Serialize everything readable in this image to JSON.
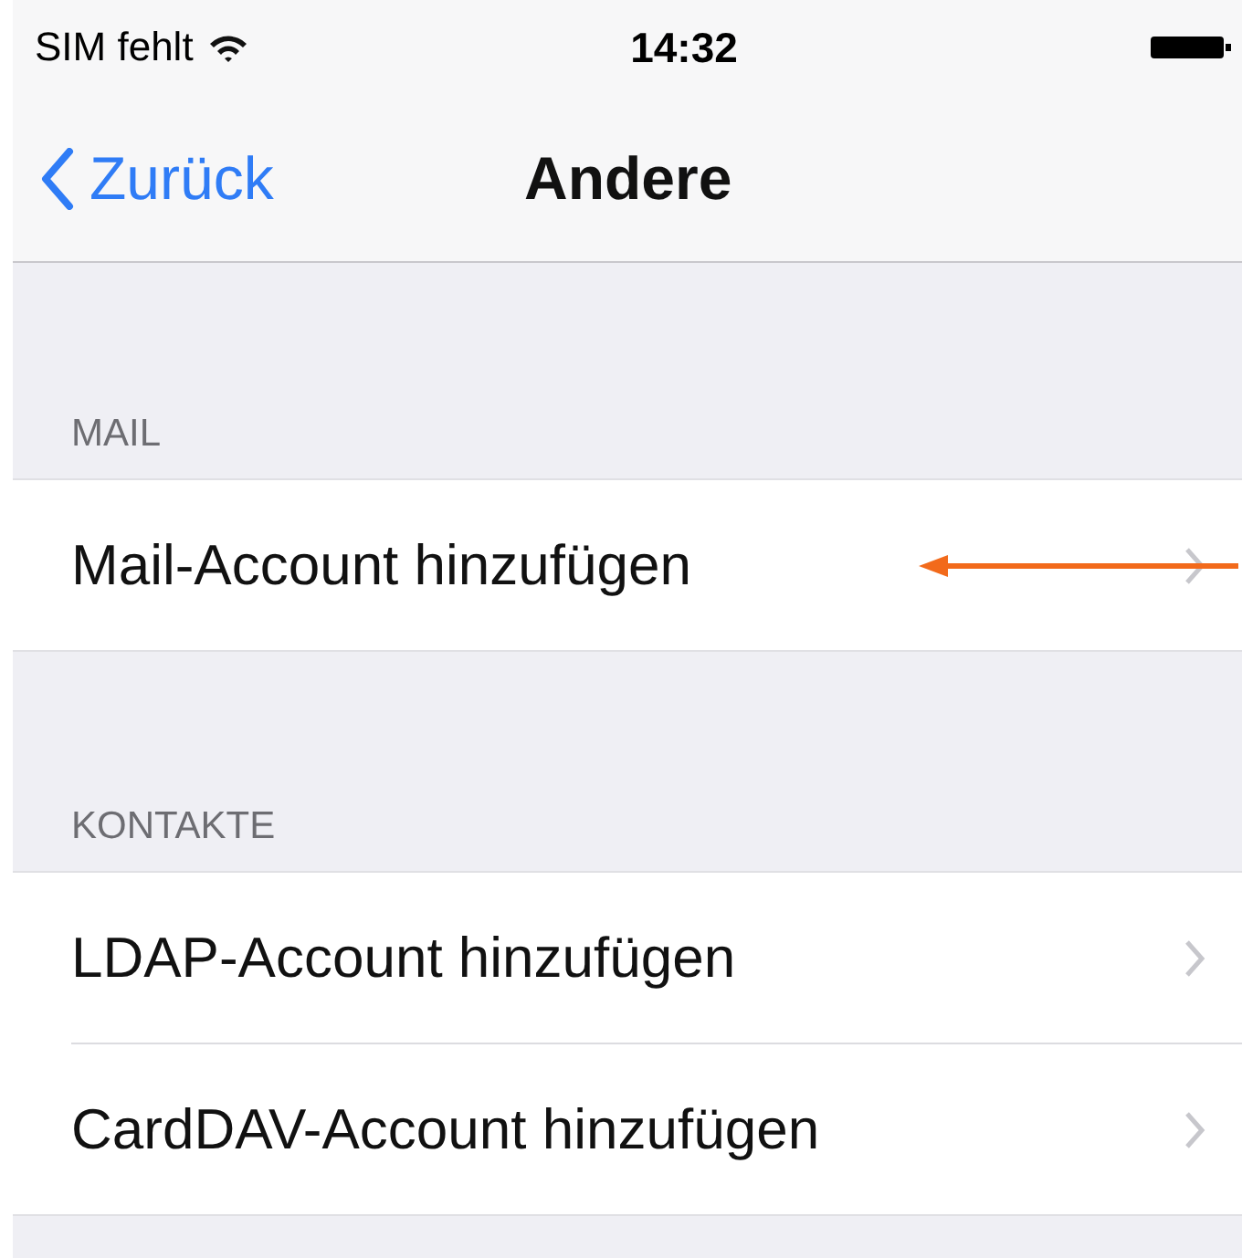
{
  "status_bar": {
    "carrier": "SIM fehlt",
    "time": "14:32"
  },
  "nav": {
    "back": "Zurück",
    "title": "Andere"
  },
  "sections": [
    {
      "header": "MAIL",
      "rows": [
        {
          "label": "Mail-Account hinzufügen",
          "annotated": true
        }
      ]
    },
    {
      "header": "KONTAKTE",
      "rows": [
        {
          "label": "LDAP-Account hinzufügen",
          "annotated": false
        },
        {
          "label": "CardDAV-Account hinzufügen",
          "annotated": false
        }
      ]
    }
  ]
}
